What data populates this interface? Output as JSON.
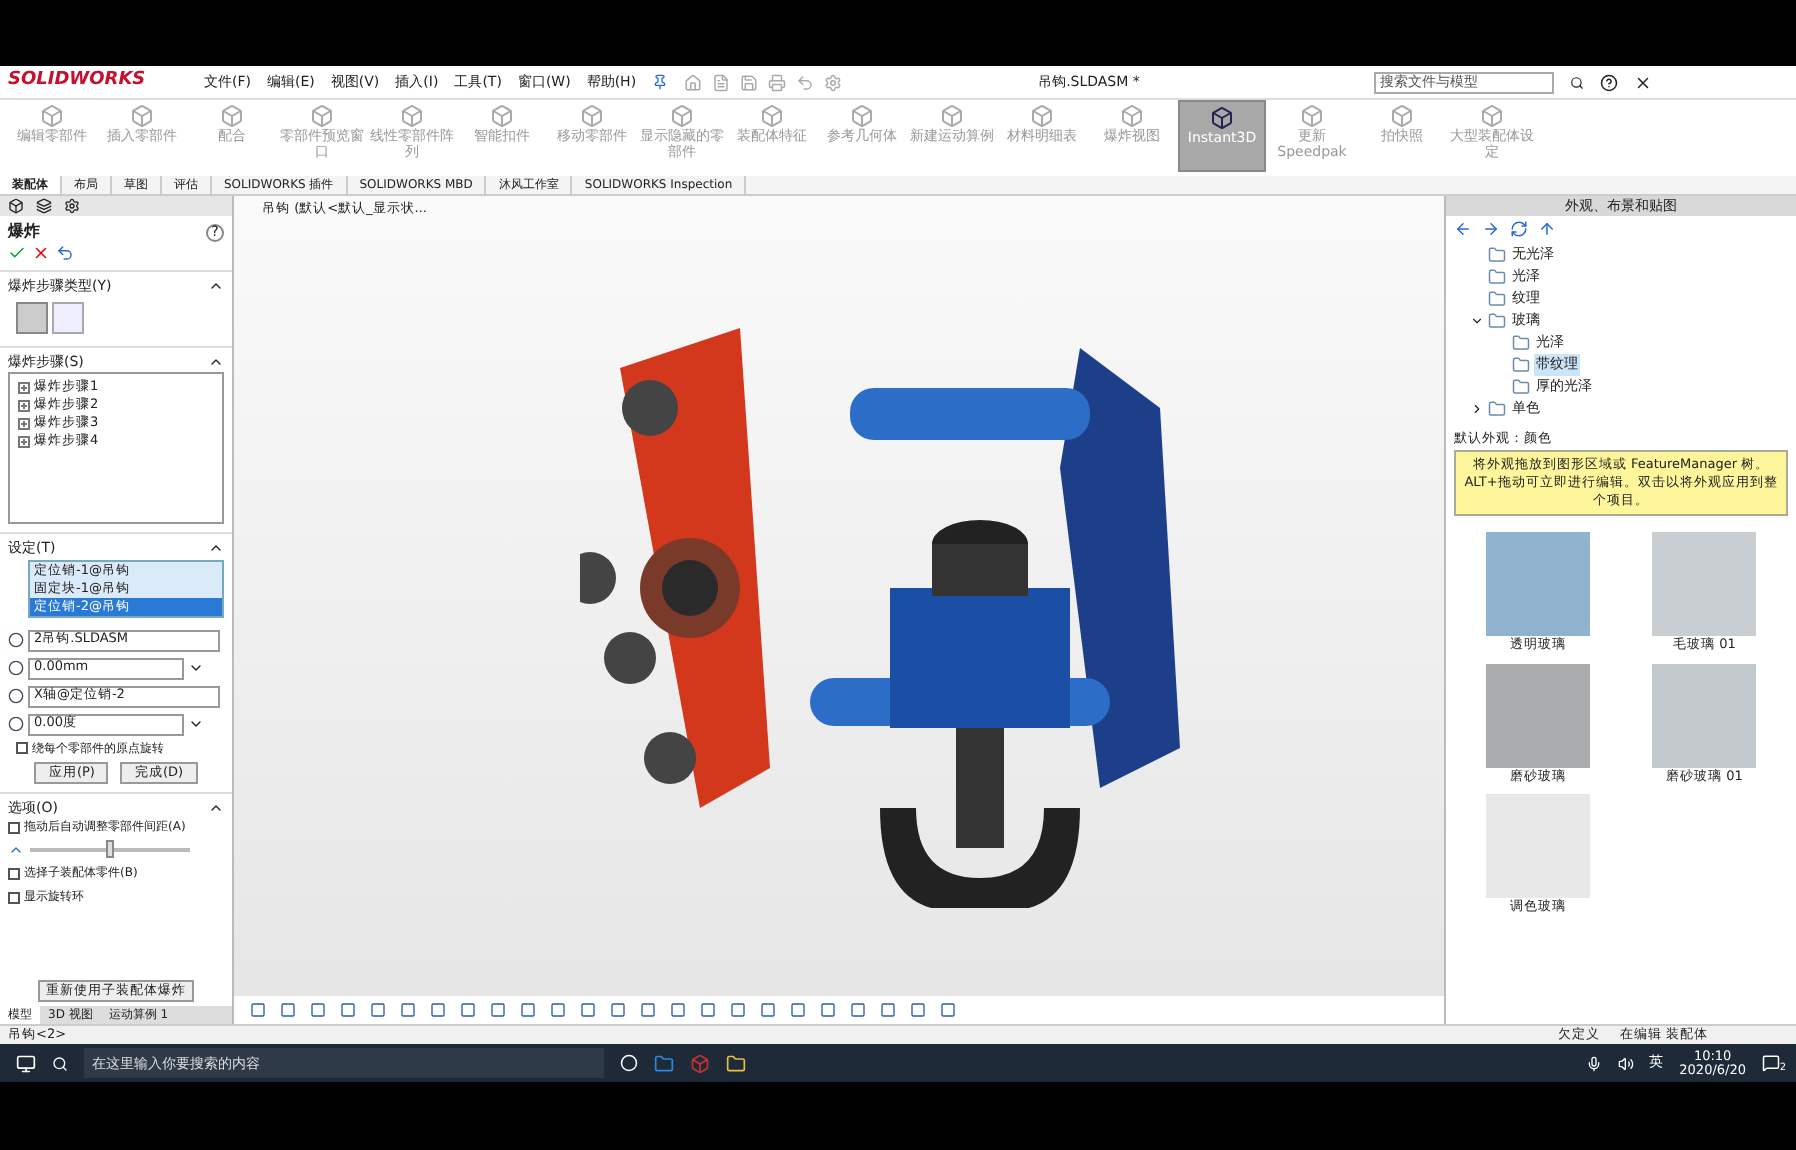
{
  "app": {
    "logo": "SOLIDWORKS",
    "menu": [
      "文件(F)",
      "编辑(E)",
      "视图(V)",
      "插入(I)",
      "工具(T)",
      "窗口(W)",
      "帮助(H)"
    ],
    "title": "吊钩.SLDASM *",
    "search": {
      "placeholder": "搜索文件与模型"
    }
  },
  "command_buttons": [
    {
      "label": "编辑零部件",
      "selected": false
    },
    {
      "label": "插入零部件",
      "selected": false
    },
    {
      "label": "配合",
      "selected": false
    },
    {
      "label": "零部件预览窗口",
      "selected": false
    },
    {
      "label": "线性零部件阵列",
      "selected": false
    },
    {
      "label": "智能扣件",
      "selected": false
    },
    {
      "label": "移动零部件",
      "selected": false
    },
    {
      "label": "显示隐藏的零部件",
      "selected": false
    },
    {
      "label": "装配体特征",
      "selected": false
    },
    {
      "label": "参考几何体",
      "selected": false
    },
    {
      "label": "新建运动算例",
      "selected": false
    },
    {
      "label": "材料明细表",
      "selected": false
    },
    {
      "label": "爆炸视图",
      "selected": false
    },
    {
      "label": "Instant3D",
      "selected": true
    },
    {
      "label": "更新 Speedpak",
      "selected": false
    },
    {
      "label": "拍快照",
      "selected": false
    },
    {
      "label": "大型装配体设定",
      "selected": false
    }
  ],
  "ribbon_tabs": [
    {
      "label": "装配体",
      "selected": true
    },
    {
      "label": "布局",
      "selected": false
    },
    {
      "label": "草图",
      "selected": false
    },
    {
      "label": "评估",
      "selected": false
    },
    {
      "label": "SOLIDWORKS 插件",
      "selected": false
    },
    {
      "label": "SOLIDWORKS MBD",
      "selected": false
    },
    {
      "label": "沐风工作室",
      "selected": false
    },
    {
      "label": "SOLIDWORKS Inspection",
      "selected": false
    }
  ],
  "property_manager": {
    "title": "爆炸",
    "help": "?",
    "sections": [
      {
        "title": "爆炸步骤类型(Y)"
      },
      {
        "title": "爆炸步骤(S)"
      },
      {
        "title": "设定(T)"
      },
      {
        "title": "选项(O)"
      }
    ],
    "steps": [
      "爆炸步骤1",
      "爆炸步骤2",
      "爆炸步骤3",
      "爆炸步骤4"
    ],
    "components": [
      {
        "label": "定位销-1@吊钩",
        "selected": false
      },
      {
        "label": "固定块-1@吊钩",
        "selected": false
      },
      {
        "label": "定位销-2@吊钩",
        "selected": true
      }
    ],
    "fields": [
      {
        "kind": "text",
        "value": "2吊钩.SLDASM"
      },
      {
        "kind": "spin",
        "value": "0.00mm"
      },
      {
        "kind": "text",
        "value": "X轴@定位销-2"
      },
      {
        "kind": "spin",
        "value": "0.00度"
      }
    ],
    "rotate_option": {
      "label": "绕每个零部件的原点旋转",
      "checked": false
    },
    "buttons": [
      "应用(P)",
      "完成(D)"
    ],
    "options": [
      {
        "kind": "check",
        "label": "拖动后自动调整零部件间距(A)",
        "checked": false
      },
      {
        "kind": "slider",
        "level": 0.48
      },
      {
        "kind": "check",
        "label": "选择子装配体零件(B)",
        "checked": false
      },
      {
        "kind": "check",
        "label": "显示旋转环",
        "checked": false
      }
    ],
    "reuse_button": "重新使用子装配体爆炸"
  },
  "bottom_tabs": [
    {
      "label": "模型",
      "selected": true
    },
    {
      "label": "3D 视图",
      "selected": false
    },
    {
      "label": "运动算例 1",
      "selected": false
    }
  ],
  "viewport": {
    "breadcrumb": "吊钩 (默认<默认_显示状..."
  },
  "task_pane": {
    "title": "外观、布景和贴图",
    "tree": [
      {
        "label": "无光泽",
        "selected": false
      },
      {
        "label": "光泽",
        "selected": false
      },
      {
        "label": "纹理",
        "selected": false
      },
      {
        "label": "玻璃",
        "selected": false,
        "expanded": true,
        "children": [
          {
            "label": "光泽",
            "selected": false
          },
          {
            "label": "带纹理",
            "selected": true
          },
          {
            "label": "厚的光泽",
            "selected": false
          }
        ]
      },
      {
        "label": "单色",
        "selected": false,
        "expanded": false
      }
    ],
    "default_label": "默认外观：颜色",
    "tip": "将外观拖放到图形区域或 FeatureManager 树。ALT+拖动可立即进行编辑。双击以将外观应用到整个项目。",
    "swatches": [
      {
        "label": "透明玻璃",
        "color": "#8fb3cf"
      },
      {
        "label": "毛玻璃 01",
        "color": "#c9ced3"
      },
      {
        "label": "磨砂玻璃",
        "color": "#a9abad"
      },
      {
        "label": "磨砂玻璃 01",
        "color": "#c3c9cc"
      },
      {
        "label": "调色玻璃",
        "color": "#e8e8e8"
      }
    ]
  },
  "status_bar": {
    "left": "吊钩<2>",
    "right": [
      "欠定义",
      "在编辑 装配体"
    ]
  },
  "taskbar": {
    "search": {
      "placeholder": "在这里输入你要搜索的内容"
    },
    "ime": "英",
    "time": "10:10",
    "date": "2020/6/20",
    "notifications": "2"
  }
}
